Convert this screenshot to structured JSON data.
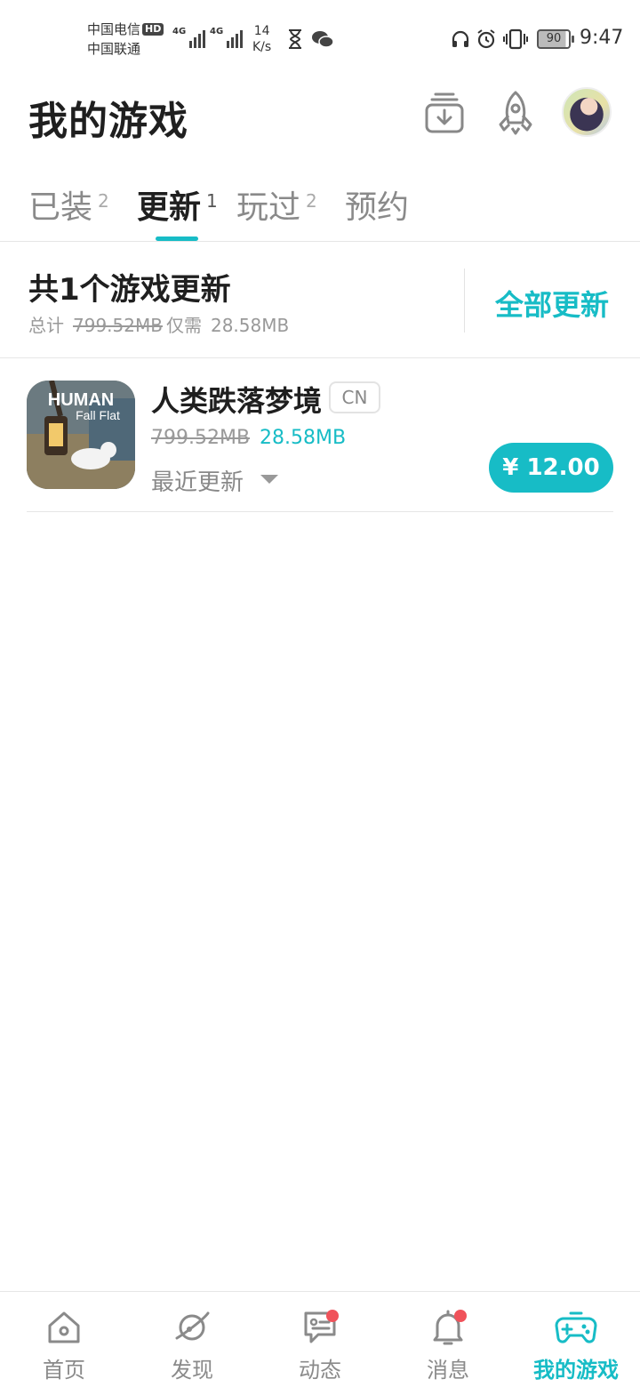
{
  "status_bar": {
    "carrier_1": "中国电信",
    "hd_badge": "HD",
    "carrier_2": "中国联通",
    "net_1": "4G",
    "net_2": "4G",
    "speed_value": "14",
    "speed_unit": "K/s",
    "battery": "90",
    "time": "9:47"
  },
  "header": {
    "title": "我的游戏",
    "download_icon": "download-tray-icon",
    "rocket_icon": "rocket-icon",
    "avatar": "user-avatar"
  },
  "tabs": [
    {
      "label": "已装",
      "count": "2",
      "active": false
    },
    {
      "label": "更新",
      "count": "1",
      "active": true
    },
    {
      "label": "玩过",
      "count": "2",
      "active": false
    },
    {
      "label": "预约",
      "count": "",
      "active": false
    }
  ],
  "summary": {
    "title": "共1个游戏更新",
    "total_label": "总计",
    "total_size": "799.52MB",
    "only_label": "仅需",
    "need_size": "28.58MB",
    "update_all": "全部更新"
  },
  "games": [
    {
      "name": "人类跌落梦境",
      "region": "CN",
      "icon_text_1": "HUMAN",
      "icon_text_2": "Fall Flat",
      "size_old": "799.52MB",
      "size_new": "28.58MB",
      "recent_label": "最近更新",
      "price": "¥ 12.00"
    }
  ],
  "bottom_nav": [
    {
      "label": "首页",
      "icon": "home-icon",
      "badge": false,
      "active": false
    },
    {
      "label": "发现",
      "icon": "planet-icon",
      "badge": false,
      "active": false
    },
    {
      "label": "动态",
      "icon": "feed-chat-icon",
      "badge": true,
      "active": false
    },
    {
      "label": "消息",
      "icon": "bell-icon",
      "badge": true,
      "active": false
    },
    {
      "label": "我的游戏",
      "icon": "gamepad-icon",
      "badge": false,
      "active": true
    }
  ],
  "colors": {
    "accent": "#17bcc6",
    "badge_red": "#f0525a",
    "text_primary": "#1f1f1f",
    "text_secondary": "#8a8a8a"
  }
}
